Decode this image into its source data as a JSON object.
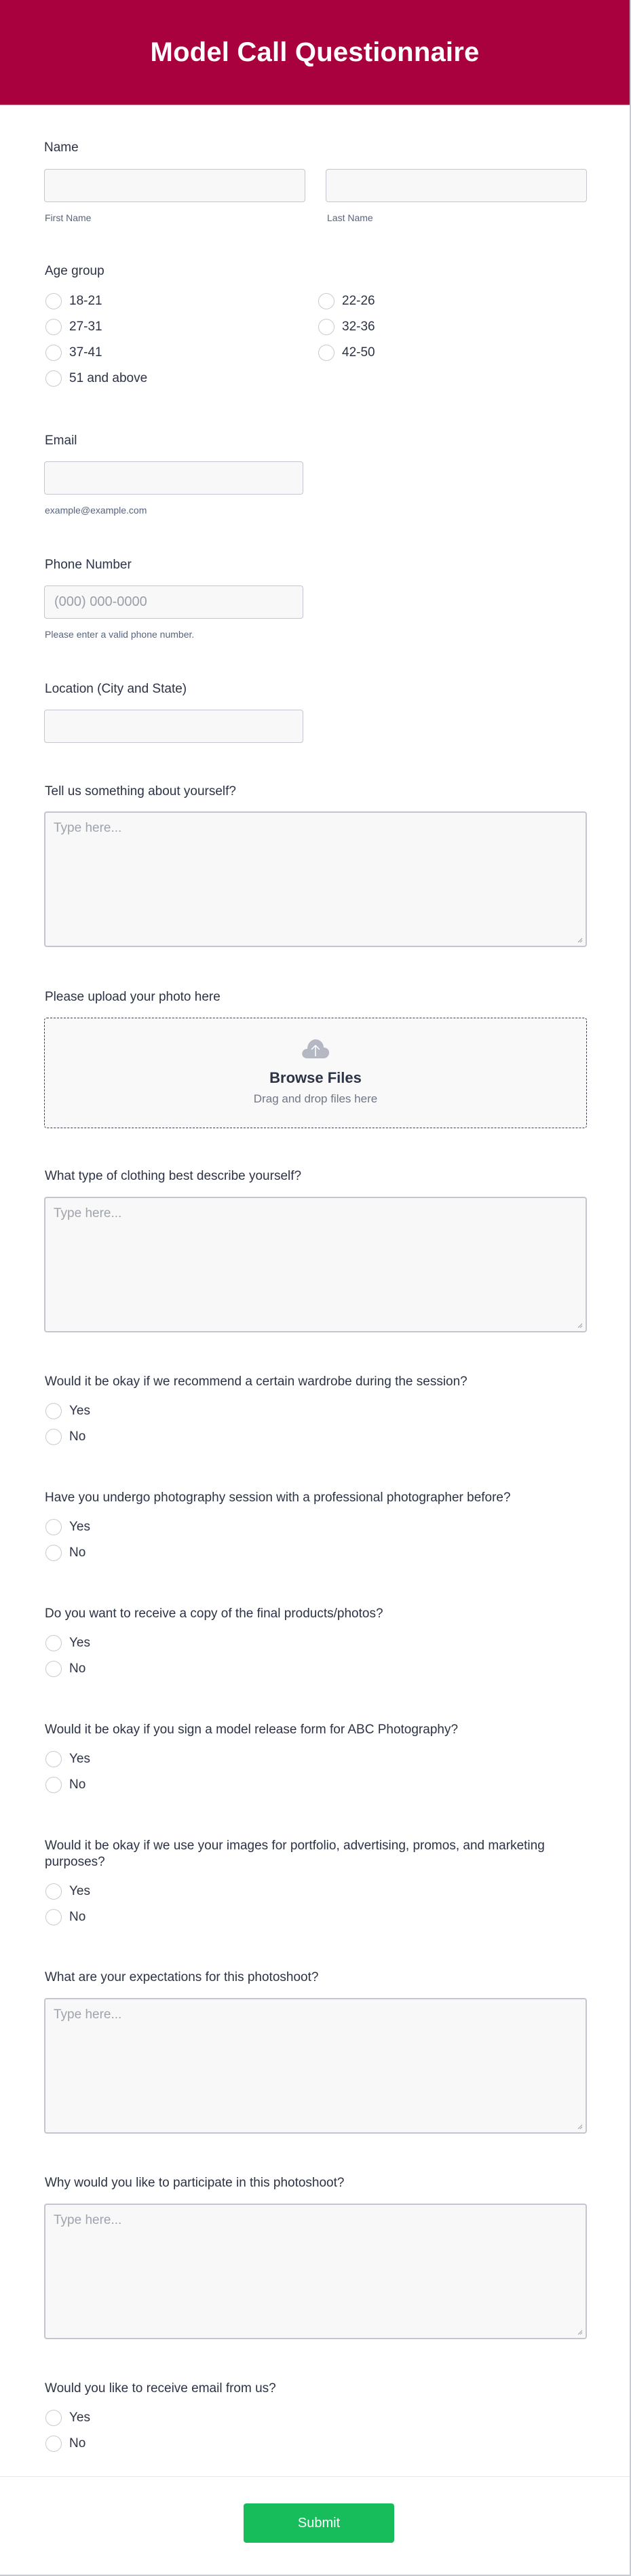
{
  "header": {
    "title": "Model Call Questionnaire",
    "background": "#a8013d"
  },
  "name": {
    "label": "Name",
    "first": {
      "value": "",
      "sublabel": "First Name"
    },
    "last": {
      "value": "",
      "sublabel": "Last Name"
    }
  },
  "age_group": {
    "label": "Age group",
    "options": [
      "18-21",
      "22-26",
      "27-31",
      "32-36",
      "37-41",
      "42-50",
      "51 and above"
    ]
  },
  "email": {
    "label": "Email",
    "value": "",
    "sublabel": "example@example.com"
  },
  "phone": {
    "label": "Phone Number",
    "placeholder": "(000) 000-0000",
    "sublabel": "Please enter a valid phone number."
  },
  "location": {
    "label": "Location (City and State)",
    "value": ""
  },
  "about": {
    "label": "Tell us something about yourself?",
    "placeholder": "Type here..."
  },
  "upload": {
    "label": "Please upload your photo here",
    "browse": "Browse Files",
    "hint": "Drag and drop files here",
    "icon": "cloud-upload-icon"
  },
  "clothing": {
    "label": "What type of clothing best describe yourself?",
    "placeholder": "Type here..."
  },
  "yes_no_questions": [
    {
      "label": "Would it be okay if we recommend a certain wardrobe during the session?",
      "options": [
        "Yes",
        "No"
      ]
    },
    {
      "label": "Have you undergo photography session with a professional photographer before?",
      "options": [
        "Yes",
        "No"
      ]
    },
    {
      "label": "Do you want to receive a copy of the final products/photos?",
      "options": [
        "Yes",
        "No"
      ]
    },
    {
      "label": "Would it be okay if you sign a model release form for ABC Photography?",
      "options": [
        "Yes",
        "No"
      ]
    },
    {
      "label": "Would it be okay if we use your images for portfolio, advertising, promos, and marketing purposes?",
      "options": [
        "Yes",
        "No"
      ]
    }
  ],
  "expectations": {
    "label": "What are your expectations for this photoshoot?",
    "placeholder": "Type here..."
  },
  "participate": {
    "label": "Why would you like to participate in this photoshoot?",
    "placeholder": "Type here..."
  },
  "email_optin": {
    "label": "Would you like to receive email from us?",
    "options": [
      "Yes",
      "No"
    ]
  },
  "submit": {
    "label": "Submit",
    "color": "#18bd5b"
  }
}
